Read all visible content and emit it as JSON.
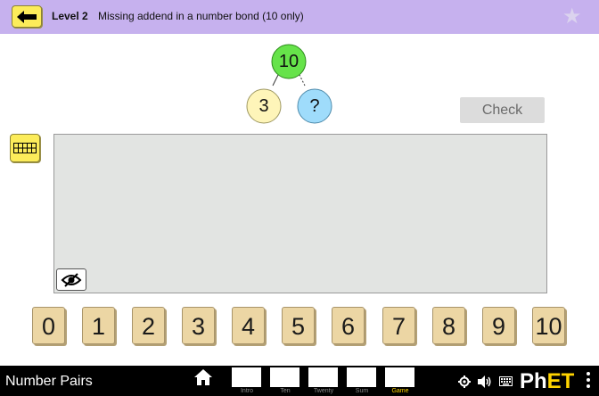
{
  "header": {
    "back_icon": "arrow-left-icon",
    "level": "Level 2",
    "description": "Missing addend in a number bond (10 only)",
    "star_icon": "star-icon"
  },
  "bond": {
    "total": "10",
    "part_left": "3",
    "part_right": "?",
    "colors": {
      "total": "#66e34a",
      "left": "#fef5b9",
      "right": "#9fdcfb"
    }
  },
  "check_label": "Check",
  "ten_frame_icon": "ten-frame-icon",
  "eye_icon": "eye-slash-icon",
  "numbers": [
    "0",
    "1",
    "2",
    "3",
    "4",
    "5",
    "6",
    "7",
    "8",
    "9",
    "10"
  ],
  "navbar": {
    "sim_title": "Number Pairs",
    "home_icon": "home-icon",
    "screens": [
      {
        "label": "Intro",
        "active": false
      },
      {
        "label": "Ten",
        "active": false
      },
      {
        "label": "Twenty",
        "active": false
      },
      {
        "label": "Sum",
        "active": false
      },
      {
        "label": "Game",
        "active": true
      }
    ],
    "icons": [
      "gear-icon",
      "speaker-icon",
      "keyboard-icon"
    ],
    "logo_text_ph": "Ph",
    "logo_text_et": "ET"
  }
}
